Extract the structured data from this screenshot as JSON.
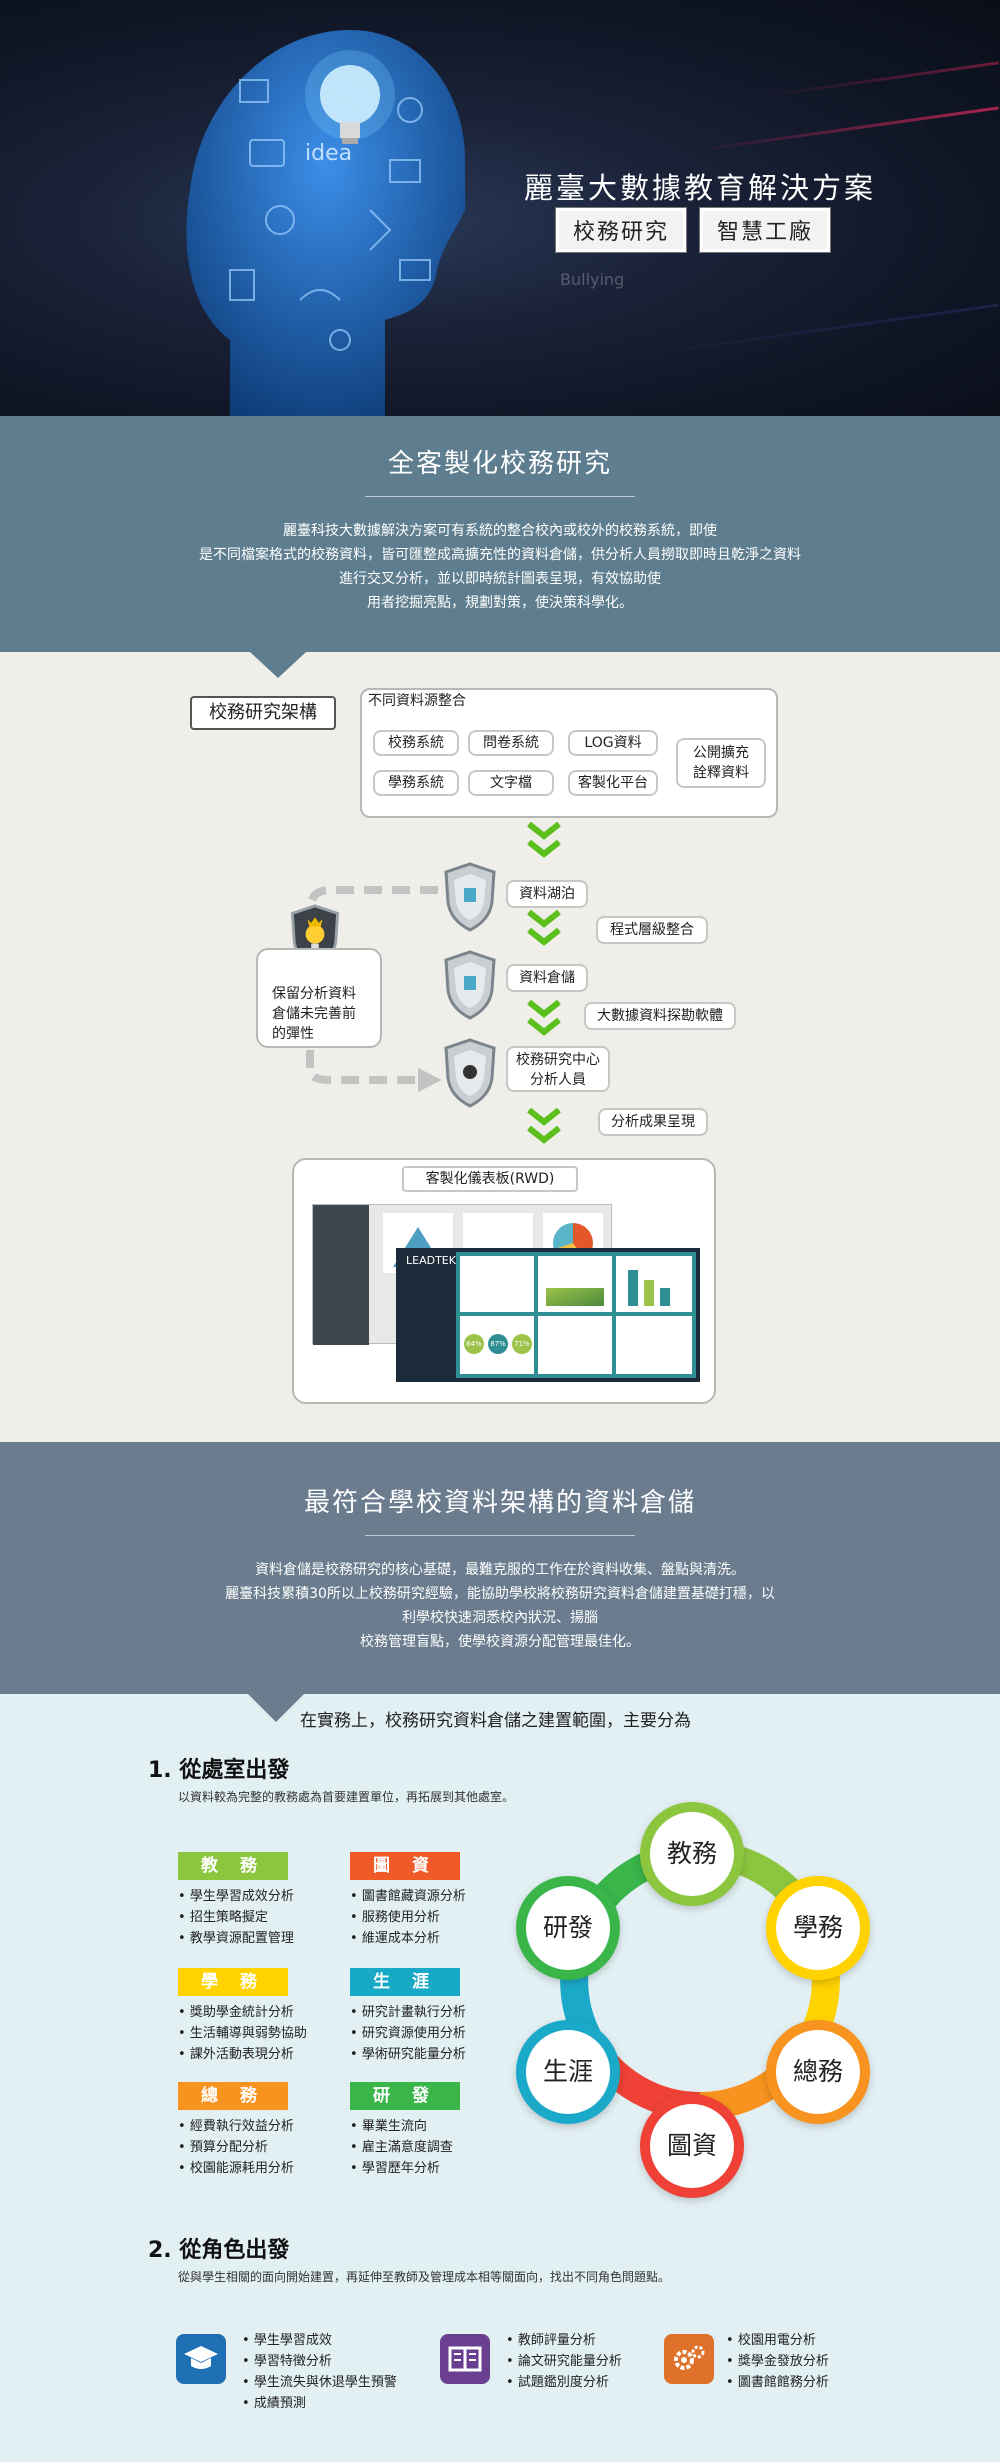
{
  "hero": {
    "title": "麗臺大數據教育解決方案",
    "tags": [
      "校務研究",
      "智慧工廠"
    ],
    "chalk_words": [
      "idea",
      "Bullying"
    ]
  },
  "section1": {
    "title": "全客製化校務研究",
    "lines": [
      "麗臺科技大數據解決方案可有系統的整合校內或校外的校務系統，即使",
      "是不同檔案格式的校務資料，皆可匯整成高擴充性的資料倉儲，供分析人員撈取即時且乾淨之資料",
      "進行交叉分析，並以即時統計圖表呈現，有效協助使",
      "用者挖掘亮點，規劃對策，使決策科學化。"
    ]
  },
  "architecture": {
    "frame_label": "校務研究架構",
    "sources_title": "不同資料源整合",
    "sources": [
      "校務系統",
      "問卷系統",
      "LOG資料",
      "學務系統",
      "文字檔",
      "客製化平台"
    ],
    "open_source": "公開擴充\n詮釋資料",
    "stages": [
      "資料湖泊",
      "資料倉儲",
      "校務研究中心\n分析人員"
    ],
    "steps": [
      "程式層級整合",
      "大數據資料探勘軟體",
      "分析成果呈現"
    ],
    "elasticity": "保留分析資料\n倉儲未完善前\n的彈性",
    "dashboard_title": "客製化儀表板(RWD)",
    "dashboard_brand": "LEADTEK",
    "dashboard_percents": [
      "64%",
      "87%",
      "71%"
    ]
  },
  "section2": {
    "title": "最符合學校資料架構的資料倉儲",
    "lines": [
      "資料倉儲是校務研究的核心基礎，最難克服的工作在於資料收集、盤點與清洗。",
      "麗臺科技累積30所以上校務研究經驗，能協助學校將校務研究資料倉儲建置基礎打穩，以",
      "利學校快速洞悉校內狀況、揚腦",
      "校務管理盲點，使學校資源分配管理最佳化。"
    ]
  },
  "scope": {
    "intro": "在實務上，校務研究資料倉儲之建置範圍，主要分為",
    "office": {
      "heading": "1. 從處室出發",
      "sub": "以資料較為完整的教務處為首要建置單位，再拓展到其他處室。",
      "groups": [
        {
          "name": "教 務",
          "color": "#8cc63f",
          "items": [
            "學生學習成效分析",
            "招生策略擬定",
            "教學資源配置管理"
          ]
        },
        {
          "name": "圖 資",
          "color": "#ef5a28",
          "items": [
            "圖書館藏資源分析",
            "服務使用分析",
            "維運成本分析"
          ]
        },
        {
          "name": "學 務",
          "color": "#ffd200",
          "items": [
            "獎助學金統計分析",
            "生活輔導與弱勢協助",
            "課外活動表現分析"
          ]
        },
        {
          "name": "生 涯",
          "color": "#17a9c6",
          "items": [
            "研究計畫執行分析",
            "研究資源使用分析",
            "學術研究能量分析"
          ]
        },
        {
          "name": "總 務",
          "color": "#f7931e",
          "items": [
            "經費執行效益分析",
            "預算分配分析",
            "校園能源耗用分析"
          ]
        },
        {
          "name": "研 發",
          "color": "#39b54a",
          "items": [
            "畢業生流向",
            "雇主滿意度調查",
            "學習歷年分析"
          ]
        }
      ],
      "ring": [
        {
          "label": "教務",
          "color": "#8cc63f"
        },
        {
          "label": "學務",
          "color": "#ffd200"
        },
        {
          "label": "總務",
          "color": "#f7931e"
        },
        {
          "label": "圖資",
          "color": "#ef4136"
        },
        {
          "label": "生涯",
          "color": "#1ba9c9"
        },
        {
          "label": "研發",
          "color": "#39b54a"
        }
      ]
    },
    "role": {
      "heading": "2. 從角色出發",
      "sub": "從與學生相關的面向開始建置，再延伸至教師及管理成本相等關面向，找出不同角色問題點。",
      "students": [
        "學生學習成效",
        "學習特徵分析",
        "學生流失與休退學生預警",
        "成績預測"
      ],
      "teachers": [
        "教師評量分析",
        "論文研究能量分析",
        "試題鑑別度分析"
      ],
      "admin": [
        "校園用電分析",
        "獎學金發放分析",
        "圖書館館務分析"
      ],
      "icon_colors": [
        "#1f6fb4",
        "#6a3f8f",
        "#e0712b"
      ]
    }
  }
}
